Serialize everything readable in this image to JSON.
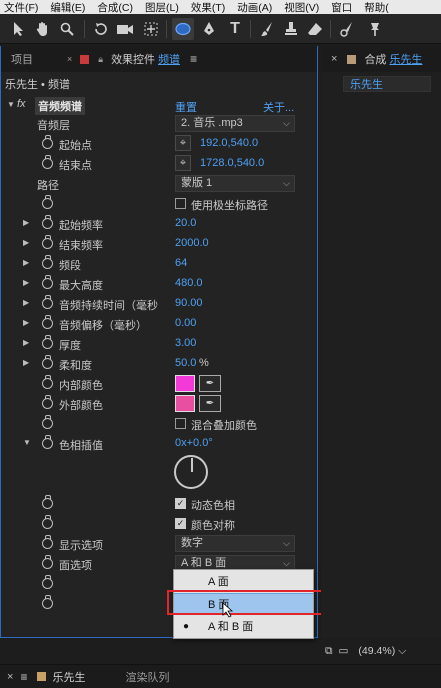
{
  "menubar": [
    "文件(F)",
    "编辑(E)",
    "合成(C)",
    "图层(L)",
    "效果(T)",
    "动画(A)",
    "视图(V)",
    "窗口",
    "帮助("
  ],
  "toolbar": {
    "icons": [
      "selection-arrow-icon",
      "hand-icon",
      "zoom-icon",
      "rotate-icon",
      "camera-icon",
      "pan-behind-icon",
      "ellipse-icon",
      "pen-icon",
      "text-icon",
      "brush-icon",
      "clone-stamp-icon",
      "eraser-icon",
      "roto-brush-icon",
      "puppet-pin-icon"
    ],
    "text_tool": "T"
  },
  "left_panel": {
    "tab_project": "项目",
    "tab_effects_prefix": "效果控件",
    "tab_effects_layer": "频谱",
    "breadcrumb": "乐先生 • 频谱",
    "effect": {
      "fx": "fx",
      "name": "音频频谱",
      "reset": "重置",
      "about": "关于..."
    },
    "rows": {
      "audio_layer": {
        "label": "音频层",
        "value": "2. 音乐 .mp3"
      },
      "start_point": {
        "label": "起始点",
        "value": "192.0,540.0"
      },
      "end_point": {
        "label": "结束点",
        "value": "1728.0,540.0"
      },
      "path": {
        "label": "路径",
        "value": "蒙版 1"
      },
      "polar": {
        "label": "使用极坐标路径"
      },
      "start_freq": {
        "label": "起始频率",
        "value": "20.0"
      },
      "end_freq": {
        "label": "结束频率",
        "value": "2000.0"
      },
      "bands": {
        "label": "频段",
        "value": "64"
      },
      "max_height": {
        "label": "最大高度",
        "value": "480.0"
      },
      "duration": {
        "label": "音频持续时间（毫秒",
        "value": "90.00"
      },
      "offset": {
        "label": "音频偏移（毫秒）",
        "value": "0.00"
      },
      "thickness": {
        "label": "厚度",
        "value": "3.00"
      },
      "softness": {
        "label": "柔和度",
        "value": "50.0",
        "unit": "%"
      },
      "inside_color": {
        "label": "内部颜色",
        "color": "#f33ad9"
      },
      "outside_color": {
        "label": "外部颜色",
        "color": "#e84fa0"
      },
      "blend": {
        "label": "混合叠加颜色"
      },
      "hue": {
        "label": "色相插值",
        "value": "0x+0.0°"
      },
      "dynamic_hue": {
        "label": "动态色相"
      },
      "color_symmetry": {
        "label": "颜色对称"
      },
      "display_options": {
        "label": "显示选项",
        "value": "数字"
      },
      "side_options": {
        "label": "面选项",
        "value": "A 和 B 面"
      }
    },
    "popup": {
      "options": [
        "A 面",
        "B 面",
        "A 和 B 面"
      ],
      "selected_index": 2,
      "hovered_index": 1
    }
  },
  "right_panel": {
    "tab_prefix": "合成",
    "tab_name": "乐先生",
    "comp_chip": "乐先生",
    "zoom": "(49.4%)"
  },
  "bottom": {
    "timeline": "乐先生",
    "render_queue": "渲染队列"
  },
  "colors": {
    "accent": "#4ea1f3",
    "highlight": "#9ec5ee",
    "annotation": "#e0262b"
  }
}
